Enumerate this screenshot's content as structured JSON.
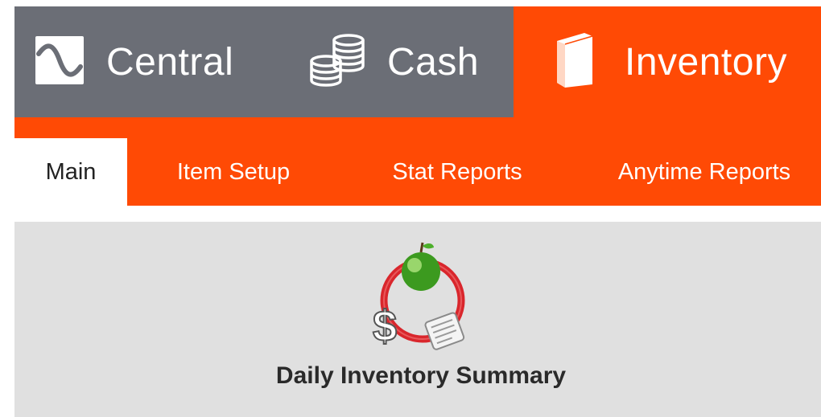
{
  "modules": {
    "central": {
      "label": "Central",
      "icon": "wave-icon"
    },
    "cash": {
      "label": "Cash",
      "icon": "coins-icon"
    },
    "inventory": {
      "label": "Inventory",
      "icon": "book-icon",
      "active": true
    }
  },
  "sub_nav": {
    "tabs": [
      {
        "label": "Main",
        "active": true
      },
      {
        "label": "Item Setup"
      },
      {
        "label": "Stat Reports"
      },
      {
        "label": "Anytime Reports"
      }
    ]
  },
  "content": {
    "report": {
      "label": "Daily Inventory Summary",
      "icon": "daily-inventory-summary-icon"
    }
  },
  "colors": {
    "accent": "#ff4a05",
    "inactive_module": "#6b6e76",
    "content_bg": "#e0e0e0"
  }
}
